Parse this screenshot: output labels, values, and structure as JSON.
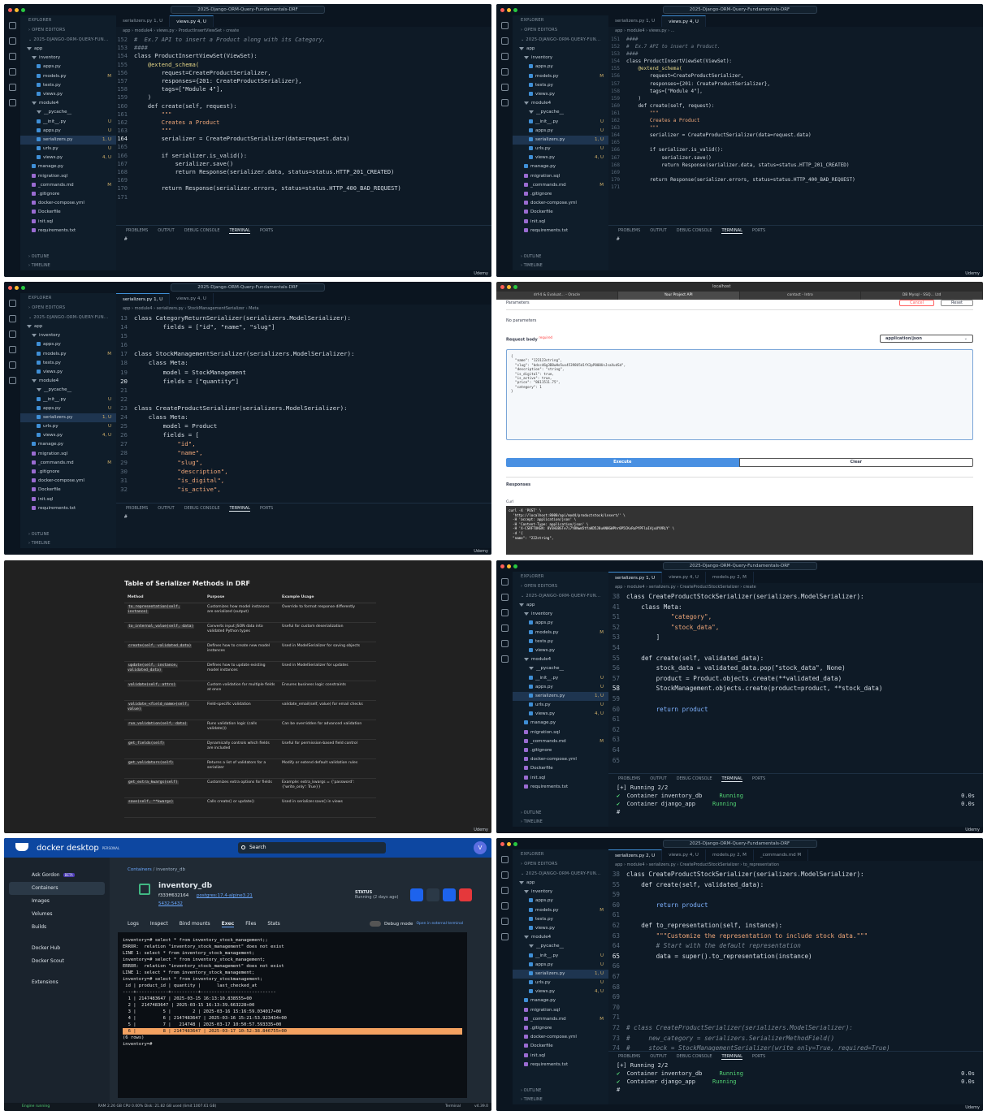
{
  "vscode": {
    "window_title": "2025-Django-ORM-Query-Fundamentals-DRF",
    "explorer_label": "EXPLORER",
    "open_editors": "OPEN EDITORS",
    "project": "2025-DJANGO-ORM-QUERY-FUN...",
    "outline": "OUTLINE",
    "timeline": "TIMELINE",
    "terminal_tabs": [
      "PROBLEMS",
      "OUTPUT",
      "DEBUG CONSOLE",
      "TERMINAL",
      "PORTS"
    ],
    "udemy": "Udemy",
    "tree": [
      {
        "name": "app",
        "type": "dir",
        "status": ""
      },
      {
        "name": "inventory",
        "type": "dir",
        "status": ""
      },
      {
        "name": "apps.py",
        "type": "py",
        "status": ""
      },
      {
        "name": "models.py",
        "type": "py",
        "status": "M"
      },
      {
        "name": "tests.py",
        "type": "py",
        "status": ""
      },
      {
        "name": "views.py",
        "type": "py",
        "status": ""
      },
      {
        "name": "module4",
        "type": "dir",
        "status": ""
      },
      {
        "name": "__pycache__",
        "type": "dir",
        "status": ""
      },
      {
        "name": "__init__.py",
        "type": "py",
        "status": "U"
      },
      {
        "name": "apps.py",
        "type": "py",
        "status": "U"
      },
      {
        "name": "serializers.py",
        "type": "py",
        "status": "1, U"
      },
      {
        "name": "urls.py",
        "type": "py",
        "status": "U"
      },
      {
        "name": "views.py",
        "type": "py",
        "status": "4, U"
      },
      {
        "name": "manage.py",
        "type": "py",
        "status": ""
      },
      {
        "name": "migration.sql",
        "type": "f",
        "status": ""
      },
      {
        "name": "_commands.md",
        "type": "f",
        "status": "M"
      },
      {
        "name": ".gitignore",
        "type": "f",
        "status": ""
      },
      {
        "name": "docker-compose.yml",
        "type": "f",
        "status": ""
      },
      {
        "name": "Dockerfile",
        "type": "f",
        "status": ""
      },
      {
        "name": "init.sql",
        "type": "f",
        "status": ""
      },
      {
        "name": "requirements.txt",
        "type": "f",
        "status": ""
      }
    ]
  },
  "panel1": {
    "tabs": [
      "serializers.py 1, U",
      "views.py 4, U"
    ],
    "crumb": "app › module4 › views.py › ProductInsertViewSet › create",
    "lines": [
      {
        "n": "152",
        "t": "#  Ex.7 API to insert a Product along with its Category.",
        "c": "cm"
      },
      {
        "n": "153",
        "t": "####",
        "c": "cm"
      },
      {
        "n": "154",
        "t": "class ProductInsertViewSet(ViewSet):",
        "c": ""
      },
      {
        "n": "155",
        "t": "    @extend_schema(",
        "c": "fn"
      },
      {
        "n": "156",
        "t": "        request=CreateProductSerializer,",
        "c": ""
      },
      {
        "n": "157",
        "t": "        responses={201: CreateProductSerializer},",
        "c": ""
      },
      {
        "n": "158",
        "t": "        tags=[\"Module 4\"],",
        "c": ""
      },
      {
        "n": "159",
        "t": "    )",
        "c": ""
      },
      {
        "n": "160",
        "t": "    def create(self, request):",
        "c": ""
      },
      {
        "n": "161",
        "t": "        \"\"\"",
        "c": "str"
      },
      {
        "n": "162",
        "t": "        Creates a Product",
        "c": "str"
      },
      {
        "n": "163",
        "t": "        \"\"\"",
        "c": "str"
      },
      {
        "n": "164",
        "t": "        serializer = CreateProductSerializer(data=request.data)",
        "c": "cur"
      },
      {
        "n": "165",
        "t": "",
        "c": ""
      },
      {
        "n": "166",
        "t": "        if serializer.is_valid():",
        "c": ""
      },
      {
        "n": "167",
        "t": "            serializer.save()",
        "c": ""
      },
      {
        "n": "168",
        "t": "            return Response(serializer.data, status=status.HTTP_201_CREATED)",
        "c": ""
      },
      {
        "n": "169",
        "t": "",
        "c": ""
      },
      {
        "n": "170",
        "t": "        return Response(serializer.errors, status=status.HTTP_400_BAD_REQUEST)",
        "c": ""
      },
      {
        "n": "171",
        "t": "",
        "c": ""
      }
    ],
    "term": [
      "#"
    ]
  },
  "panel2": {
    "tabs": [
      "serializers.py 1, U",
      "views.py 4, U"
    ],
    "crumb": "app › module4 › views.py › ...",
    "lines": [
      {
        "n": "151",
        "t": "####",
        "c": "cm"
      },
      {
        "n": "152",
        "t": "#  Ex.7 API to insert a Product.",
        "c": "cm"
      },
      {
        "n": "153",
        "t": "####",
        "c": "cm"
      },
      {
        "n": "154",
        "t": "class ProductInsertViewSet(ViewSet):",
        "c": ""
      },
      {
        "n": "155",
        "t": "    @extend_schema(",
        "c": "fn"
      },
      {
        "n": "156",
        "t": "        request=CreateProductSerializer,",
        "c": ""
      },
      {
        "n": "157",
        "t": "        responses={201: CreateProductSerializer},",
        "c": ""
      },
      {
        "n": "158",
        "t": "        tags=[\"Module 4\"],",
        "c": ""
      },
      {
        "n": "159",
        "t": "    )",
        "c": ""
      },
      {
        "n": "160",
        "t": "    def create(self, request):",
        "c": ""
      },
      {
        "n": "161",
        "t": "        \"\"\"",
        "c": "str"
      },
      {
        "n": "162",
        "t": "        Creates a Product",
        "c": "str"
      },
      {
        "n": "163",
        "t": "        \"\"\"",
        "c": "str"
      },
      {
        "n": "164",
        "t": "        serializer = CreateProductSerializer(data=request.data)",
        "c": ""
      },
      {
        "n": "165",
        "t": "",
        "c": ""
      },
      {
        "n": "166",
        "t": "        if serializer.is_valid():",
        "c": ""
      },
      {
        "n": "167",
        "t": "            serializer.save()",
        "c": ""
      },
      {
        "n": "168",
        "t": "            return Response(serializer.data, status=status.HTTP_201_CREATED)",
        "c": ""
      },
      {
        "n": "169",
        "t": "",
        "c": ""
      },
      {
        "n": "170",
        "t": "        return Response(serializer.errors, status=status.HTTP_400_BAD_REQUEST)",
        "c": ""
      },
      {
        "n": "171",
        "t": "",
        "c": ""
      }
    ],
    "term": [
      "#"
    ]
  },
  "panel3": {
    "tabs": [
      "serializers.py 1, U",
      "views.py 4, U"
    ],
    "crumb": "app › module4 › serializers.py › StockManagementSerializer › Meta",
    "lines": [
      {
        "n": "13",
        "t": "class CategoryReturnSerializer(serializers.ModelSerializer):",
        "c": ""
      },
      {
        "n": "14",
        "t": "        fields = [\"id\", \"name\", \"slug\"]",
        "c": ""
      },
      {
        "n": "15",
        "t": "",
        "c": ""
      },
      {
        "n": "16",
        "t": "",
        "c": ""
      },
      {
        "n": "17",
        "t": "class StockManagementSerializer(serializers.ModelSerializer):",
        "c": ""
      },
      {
        "n": "18",
        "t": "    class Meta:",
        "c": ""
      },
      {
        "n": "19",
        "t": "        model = StockManagement",
        "c": ""
      },
      {
        "n": "20",
        "t": "        fields = [\"quantity\"]",
        "c": "cur"
      },
      {
        "n": "21",
        "t": "",
        "c": ""
      },
      {
        "n": "22",
        "t": "",
        "c": ""
      },
      {
        "n": "23",
        "t": "class CreateProductSerializer(serializers.ModelSerializer):",
        "c": ""
      },
      {
        "n": "24",
        "t": "    class Meta:",
        "c": ""
      },
      {
        "n": "25",
        "t": "        model = Product",
        "c": ""
      },
      {
        "n": "26",
        "t": "        fields = [",
        "c": ""
      },
      {
        "n": "27",
        "t": "            \"id\",",
        "c": "str"
      },
      {
        "n": "28",
        "t": "            \"name\",",
        "c": "str"
      },
      {
        "n": "29",
        "t": "            \"slug\",",
        "c": "str"
      },
      {
        "n": "30",
        "t": "            \"description\",",
        "c": "str"
      },
      {
        "n": "31",
        "t": "            \"is_digital\",",
        "c": "str"
      },
      {
        "n": "32",
        "t": "            \"is_active\",",
        "c": "str"
      }
    ],
    "term": [
      "#"
    ]
  },
  "panel4": {
    "browser_tabs": [
      "drf-4 & Evaluat... - Oracle",
      "Your Project API",
      "contact - Intro",
      "DB Mysql - SSQ... Ltd"
    ],
    "address": "localhost",
    "parameters": "Parameters",
    "cancel": "Cancel",
    "reset": "Reset",
    "no_params": "No parameters",
    "request_body": "Request body",
    "required": "required",
    "content_type": "application/json",
    "body_lines": [
      "{",
      "  \"name\": \"123123string\",",
      "  \"slug\": \"bdcc46g3B8wHo5ux45398U5d1fX3pP000UsJsaXudSd\",",
      "  \"description\": \"string\",",
      "  \"is_digital\": true,",
      "  \"is_active\": true,",
      "  \"price\": \"8611511.75\",",
      "  \"category\": 1",
      "}"
    ],
    "execute": "Execute",
    "clear": "Clear",
    "responses": "Responses",
    "curl": "Curl",
    "curl_lines": [
      "curl -X 'POST' \\",
      "  'http://localhost:8000/api/mod4/productstock/insert/' \\",
      "  -H 'accept: application/json' \\",
      "  -H 'Content-Type: application/json' \\",
      "  -H 'X-CSRFTOKEN: 8V3H3BSTe7i7Y8Nwm5tYaKD5J8uAN0GWPhr0P5CKvRuPYPFlaIAjuUYVRLY' \\",
      "  -d '{",
      "  \"name\": \"222string\","
    ]
  },
  "panel5": {
    "title": "Table of Serializer Methods in DRF",
    "columns": [
      "Method",
      "Purpose",
      "Example Usage"
    ],
    "rows": [
      {
        "method": "to_representation(self, instance)",
        "purpose": "Customizes how model instances are serialized (output)",
        "example": "Override to format response differently"
      },
      {
        "method": "to_internal_value(self, data)",
        "purpose": "Converts input JSON data into validated Python types",
        "example": "Useful for custom deserialization"
      },
      {
        "method": "create(self, validated_data)",
        "purpose": "Defines how to create new model instances",
        "example": "Used in ModelSerializer for saving objects"
      },
      {
        "method": "update(self, instance, validated_data)",
        "purpose": "Defines how to update existing model instances",
        "example": "Used in ModelSerializer for updates"
      },
      {
        "method": "validate(self, attrs)",
        "purpose": "Custom validation for multiple fields at once",
        "example": "Ensures business logic constraints"
      },
      {
        "method": "validate_<field_name>(self, value)",
        "purpose": "Field-specific validation",
        "example": "validate_email(self, value) for email checks"
      },
      {
        "method": "run_validation(self, data)",
        "purpose": "Runs validation logic (calls validate())",
        "example": "Can be overridden for advanced validation"
      },
      {
        "method": "get_fields(self)",
        "purpose": "Dynamically controls which fields are included",
        "example": "Useful for permission-based field control"
      },
      {
        "method": "get_validators(self)",
        "purpose": "Returns a list of validators for a serializer",
        "example": "Modify or extend default validation rules"
      },
      {
        "method": "get_extra_kwargs(self)",
        "purpose": "Customizes extra options for fields",
        "example": "Example: extra_kwargs = {'password': {'write_only': True}}"
      },
      {
        "method": "save(self, **kwargs)",
        "purpose": "Calls create() or update()",
        "example": "Used in serializer.save() in views"
      }
    ]
  },
  "panel6": {
    "tabs": [
      "serializers.py 1, U",
      "views.py 4, U",
      "models.py 2, M"
    ],
    "crumb": "app › module4 › serializers.py › CreateProductStockSerializer › create",
    "lines": [
      {
        "n": "38",
        "t": "class CreateProductStockSerializer(serializers.ModelSerializer):",
        "c": ""
      },
      {
        "n": "41",
        "t": "    class Meta:",
        "c": ""
      },
      {
        "n": "51",
        "t": "            \"category\",",
        "c": "str"
      },
      {
        "n": "52",
        "t": "            \"stock_data\",",
        "c": "str"
      },
      {
        "n": "53",
        "t": "        ]",
        "c": ""
      },
      {
        "n": "54",
        "t": "",
        "c": ""
      },
      {
        "n": "55",
        "t": "    def create(self, validated_data):",
        "c": ""
      },
      {
        "n": "56",
        "t": "        stock_data = validated_data.pop(\"stock_data\", None)",
        "c": ""
      },
      {
        "n": "57",
        "t": "        product = Product.objects.create(**validated_data)",
        "c": ""
      },
      {
        "n": "58",
        "t": "        StockManagement.objects.create(product=product, **stock_data)",
        "c": "cur"
      },
      {
        "n": "59",
        "t": "",
        "c": ""
      },
      {
        "n": "60",
        "t": "        return product",
        "c": "kw"
      },
      {
        "n": "61",
        "t": "",
        "c": ""
      },
      {
        "n": "62",
        "t": "",
        "c": ""
      },
      {
        "n": "63",
        "t": "",
        "c": ""
      },
      {
        "n": "64",
        "t": "",
        "c": ""
      },
      {
        "n": "65",
        "t": "",
        "c": ""
      }
    ],
    "term": [
      "[+] Running 2/2",
      " ✔ Container inventory_db     Running",
      " ✔ Container django_app     Running",
      "#"
    ],
    "term_times": [
      "0.0s",
      "0.0s"
    ]
  },
  "panel7": {
    "brand": "docker desktop",
    "plan": "PERSONAL",
    "search": "Search",
    "side": [
      "Ask Gordon",
      "Containers",
      "Images",
      "Volumes",
      "Builds",
      "Docker Hub",
      "Docker Scout",
      "Extensions"
    ],
    "beta": "BETA",
    "crumb": [
      "Containers",
      "inventory_db"
    ],
    "container_name": "inventory_db",
    "container_id": "f333ff632164",
    "image": "postgres:17.4-alpine3.21",
    "port": "5432:5432",
    "status_label": "STATUS",
    "status_value": "Running (2 days ago)",
    "tabs": [
      "Logs",
      "Inspect",
      "Bind mounts",
      "Exec",
      "Files",
      "Stats"
    ],
    "debug_mode": "Debug mode",
    "external": "Open in external terminal",
    "shell": [
      "inventory=# select * from inventory_stock_management;;",
      "ERROR:  relation \"inventory_stock_management\" does not exist",
      "LINE 1: select * from inventory_stock_management;",
      "",
      "inventory=# select * from inventory_stock_management;",
      "ERROR:  relation \"inventory_stock_management\" does not exist",
      "LINE 1: select * from inventory_stock_management;",
      "",
      "inventory=# select * from inventory_stockmanagement;",
      " id | product_id | quantity |      last_checked_at",
      "----+------------+----------+----------------------------",
      "  1 | 2147483647 | 2025-03-15 16:13:10.838555+00",
      "  2 |  2147483647 | 2025-03-15 16:13:39.663228+00",
      "  3 |          5 |        2 | 2025-03-16 15:16:59.034017+00",
      "  4 |          6 | 2147483647 | 2025-03-16 15:21:53.923434+00",
      "  5 |          7 |   214748 | 2025-03-17 10:50:57.593335+00",
      "  6 |          8 | 2147483647 | 2025-03-17 10:52:38.846755+00",
      "(6 rows)",
      "",
      "inventory=# "
    ],
    "engine": "Engine running",
    "stats": "RAM 2.26 GB   CPU 0.00%   Disk: 21.82 GB used (limit 1007.61 GB)",
    "terminal": "Terminal",
    "version": "v4.39.0"
  },
  "panel8": {
    "tabs": [
      "serializers.py 2, U",
      "views.py 4, U",
      "models.py 2, M",
      "_commands.md M"
    ],
    "crumb": "app › module4 › serializers.py › CreateProductStockSerializer › to_representation",
    "lines": [
      {
        "n": "38",
        "t": "class CreateProductStockSerializer(serializers.ModelSerializer):",
        "c": ""
      },
      {
        "n": "55",
        "t": "    def create(self, validated_data):",
        "c": ""
      },
      {
        "n": "59",
        "t": "",
        "c": ""
      },
      {
        "n": "60",
        "t": "        return product",
        "c": "kw"
      },
      {
        "n": "61",
        "t": "",
        "c": ""
      },
      {
        "n": "62",
        "t": "    def to_representation(self, instance):",
        "c": ""
      },
      {
        "n": "63",
        "t": "        \"\"\"Customize the representation to include stock data.\"\"\"",
        "c": "str"
      },
      {
        "n": "64",
        "t": "        # Start with the default representation",
        "c": "cm"
      },
      {
        "n": "65",
        "t": "        data = super().to_representation(instance)",
        "c": "cur"
      },
      {
        "n": "66",
        "t": "",
        "c": ""
      },
      {
        "n": "67",
        "t": "",
        "c": ""
      },
      {
        "n": "68",
        "t": "",
        "c": ""
      },
      {
        "n": "69",
        "t": "",
        "c": ""
      },
      {
        "n": "70",
        "t": "",
        "c": ""
      },
      {
        "n": "71",
        "t": "",
        "c": ""
      },
      {
        "n": "72",
        "t": "# class CreateProductSerializer(serializers.ModelSerializer):",
        "c": "cm"
      },
      {
        "n": "73",
        "t": "#     new_category = serializers.SerializerMethodField()",
        "c": "cm"
      },
      {
        "n": "74",
        "t": "#     stock = StockManagementSerializer(write_only=True, required=True)",
        "c": "cm"
      }
    ],
    "term": [
      "[+] Running 2/2",
      " ✔ Container inventory_db     Running",
      " ✔ Container django_app     Running",
      "#"
    ],
    "term_times": [
      "0.0s",
      "0.0s"
    ]
  }
}
